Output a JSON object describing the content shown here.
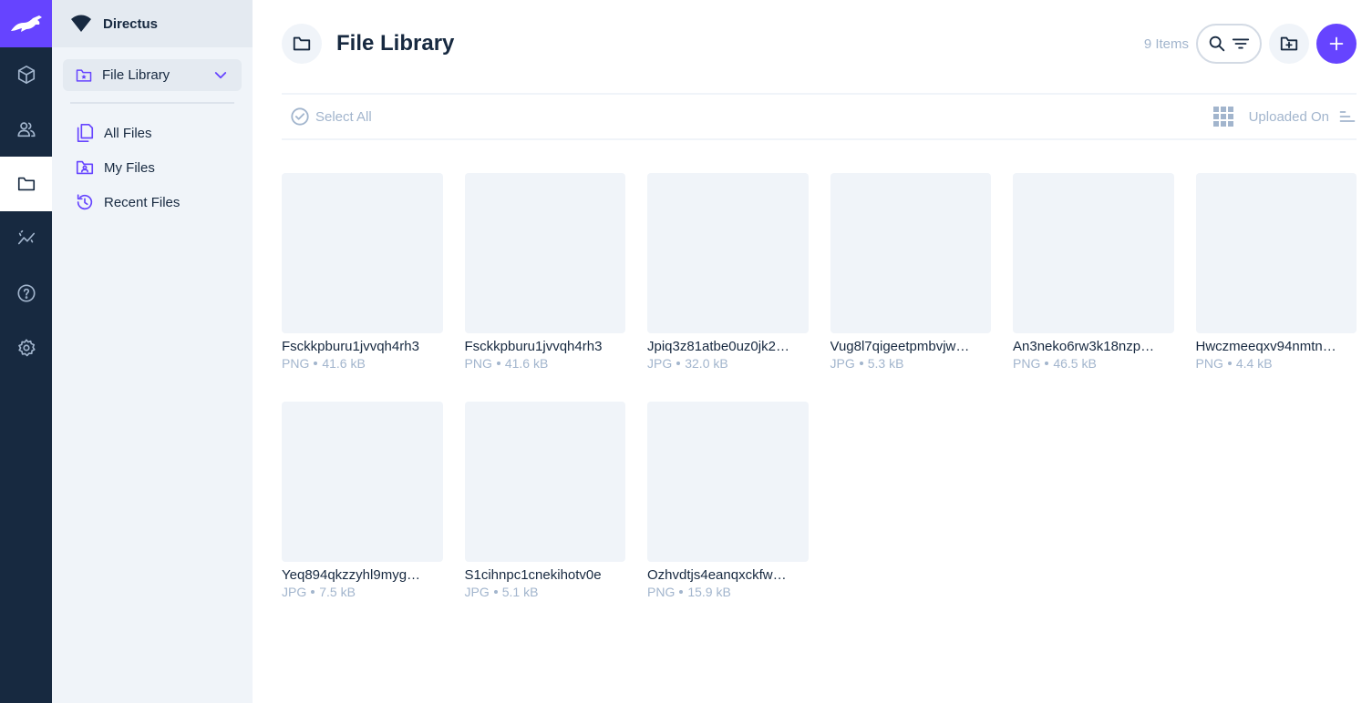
{
  "app": {
    "brand_color": "#6644ff",
    "sidebar_color": "#172940",
    "modules": [
      {
        "name": "content",
        "icon": "cube-icon",
        "active": false
      },
      {
        "name": "users",
        "icon": "users-icon",
        "active": false
      },
      {
        "name": "files",
        "icon": "folder-icon",
        "active": true
      },
      {
        "name": "insights",
        "icon": "insights-icon",
        "active": false
      },
      {
        "name": "help",
        "icon": "help-icon",
        "active": false
      },
      {
        "name": "settings",
        "icon": "gear-icon",
        "active": false
      }
    ]
  },
  "nav": {
    "project_name": "Directus",
    "group_label": "File Library",
    "items": [
      {
        "label": "All Files",
        "icon": "files-icon"
      },
      {
        "label": "My Files",
        "icon": "user-folder-icon"
      },
      {
        "label": "Recent Files",
        "icon": "history-icon"
      }
    ]
  },
  "header": {
    "title": "File Library",
    "item_count": "9 Items"
  },
  "toolbar": {
    "select_all_label": "Select All",
    "sort_label": "Uploaded On"
  },
  "files": [
    {
      "title": "Fsckkpburu1jvvqh4rh3",
      "type": "PNG",
      "size": "41.6 kB"
    },
    {
      "title": "Fsckkpburu1jvvqh4rh3",
      "type": "PNG",
      "size": "41.6 kB"
    },
    {
      "title": "Jpiq3z81atbe0uz0jk2…",
      "type": "JPG",
      "size": "32.0 kB"
    },
    {
      "title": "Vug8l7qigeetpmbvjw…",
      "type": "JPG",
      "size": "5.3 kB"
    },
    {
      "title": "An3neko6rw3k18nzp…",
      "type": "PNG",
      "size": "46.5 kB"
    },
    {
      "title": "Hwczmeeqxv94nmtn…",
      "type": "PNG",
      "size": "4.4 kB"
    },
    {
      "title": "Yeq894qkzzyhl9myg…",
      "type": "JPG",
      "size": "7.5 kB"
    },
    {
      "title": "S1cihnpc1cnekihotv0e",
      "type": "JPG",
      "size": "5.1 kB"
    },
    {
      "title": "Ozhvdtjs4eanqxckfw…",
      "type": "PNG",
      "size": "15.9 kB"
    }
  ]
}
